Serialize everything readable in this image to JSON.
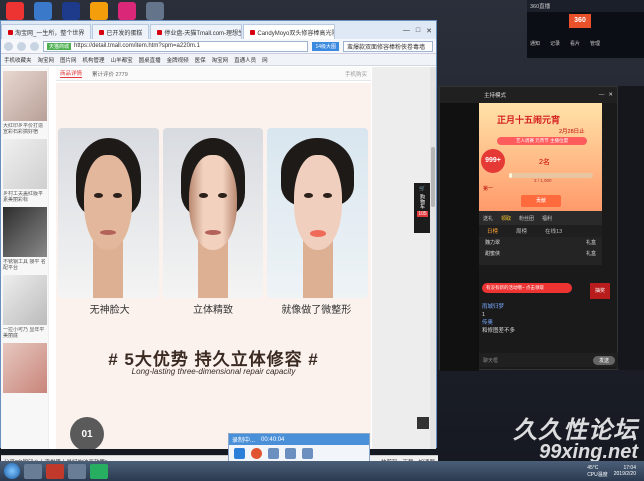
{
  "browser": {
    "tabs": [
      {
        "label": "淘宝网_一生所，整个世界"
      },
      {
        "label": "已开发的蛋糕"
      },
      {
        "label": "停业盘-天猫Tmall.com-理想生"
      },
      {
        "label": "CandyMoyo双头修容棒高光阴"
      }
    ],
    "window_controls": [
      "—",
      "□",
      "✕"
    ],
    "address": {
      "secure_tag": "天猫商城",
      "url": "https://detail.tmall.com/item.htm?spm=a220m.1",
      "zoom_badge": "14级大图",
      "search_text": "蛮爆款双面修容棒粉侠卷毒墙"
    },
    "favorites": [
      "手机收藏夹",
      "淘宝网",
      "图片网",
      "机构管理",
      "山羊都宝",
      "圆桌直播",
      "金牌视频",
      "医保",
      "淘宝网",
      "直通人员",
      "网"
    ],
    "left_captions": [
      "大红印乡平价打造 宣彩石彩搞好宿",
      "乡村工夫盖红版平 素美丽彩标",
      "不锈钢工具 接平 名配平台",
      "一拉小可乃 显年平 美丽底"
    ],
    "shop_tabs": {
      "detail": "商品详情",
      "reviews": "累计评价 2779",
      "right": "手机购买"
    },
    "face_labels": [
      "无神脸大",
      "立体精致",
      "就像做了微整形"
    ],
    "headline": "# 5大优势 持久立体修容 #",
    "subline": "Long-lasting three-dimensional repair capacity",
    "badge_number": "01",
    "cart": {
      "label": "购物车",
      "count": "105"
    },
    "status_text": "分享\"宁国印乡上演世界上最好的油画政策\"",
    "status_right": [
      "快剪辑",
      "下载",
      "加速器"
    ]
  },
  "recorder": {
    "title": "录制中...",
    "time": "00:40:04"
  },
  "stream": {
    "top_label": "主持模式",
    "banner": {
      "title": "正月十五闹元宵",
      "date": "2月28日止",
      "pill": "艺人周赛 元宵节 主播位盟",
      "hb_amount": "999+",
      "rank": "2名",
      "progress_label": "2 / 1,000",
      "progress": 0.02,
      "first_label": "第一",
      "cheer": "贡献"
    },
    "tools": [
      "送礼",
      "领取",
      "粉丝团",
      "福利"
    ],
    "tabs": [
      "日榜",
      "周榜",
      "在线13"
    ],
    "list": [
      {
        "name": "魏力翠",
        "value": "礼盒"
      },
      {
        "name": "甜蜜侠",
        "value": "礼盒"
      }
    ],
    "notice": "有没有新的活动哦~ 点击领取",
    "gift": "抽奖",
    "chat": [
      {
        "user": "雨城归梦",
        "text": "1"
      },
      {
        "user": "传奥",
        "text": "和修图差不多"
      }
    ],
    "input_placeholder": "聊天框",
    "send_label": "发送"
  },
  "video_app": {
    "title": "360直播",
    "logo": "360",
    "icons": [
      "通知",
      "记录",
      "看片",
      "管理"
    ]
  },
  "taskbar": {
    "temp": "45°C",
    "cpu": "CPU温度",
    "time": "17:04",
    "date": "2019/2/20"
  },
  "watermark": {
    "line1": "久久性论坛",
    "line2": "99xing.net"
  }
}
